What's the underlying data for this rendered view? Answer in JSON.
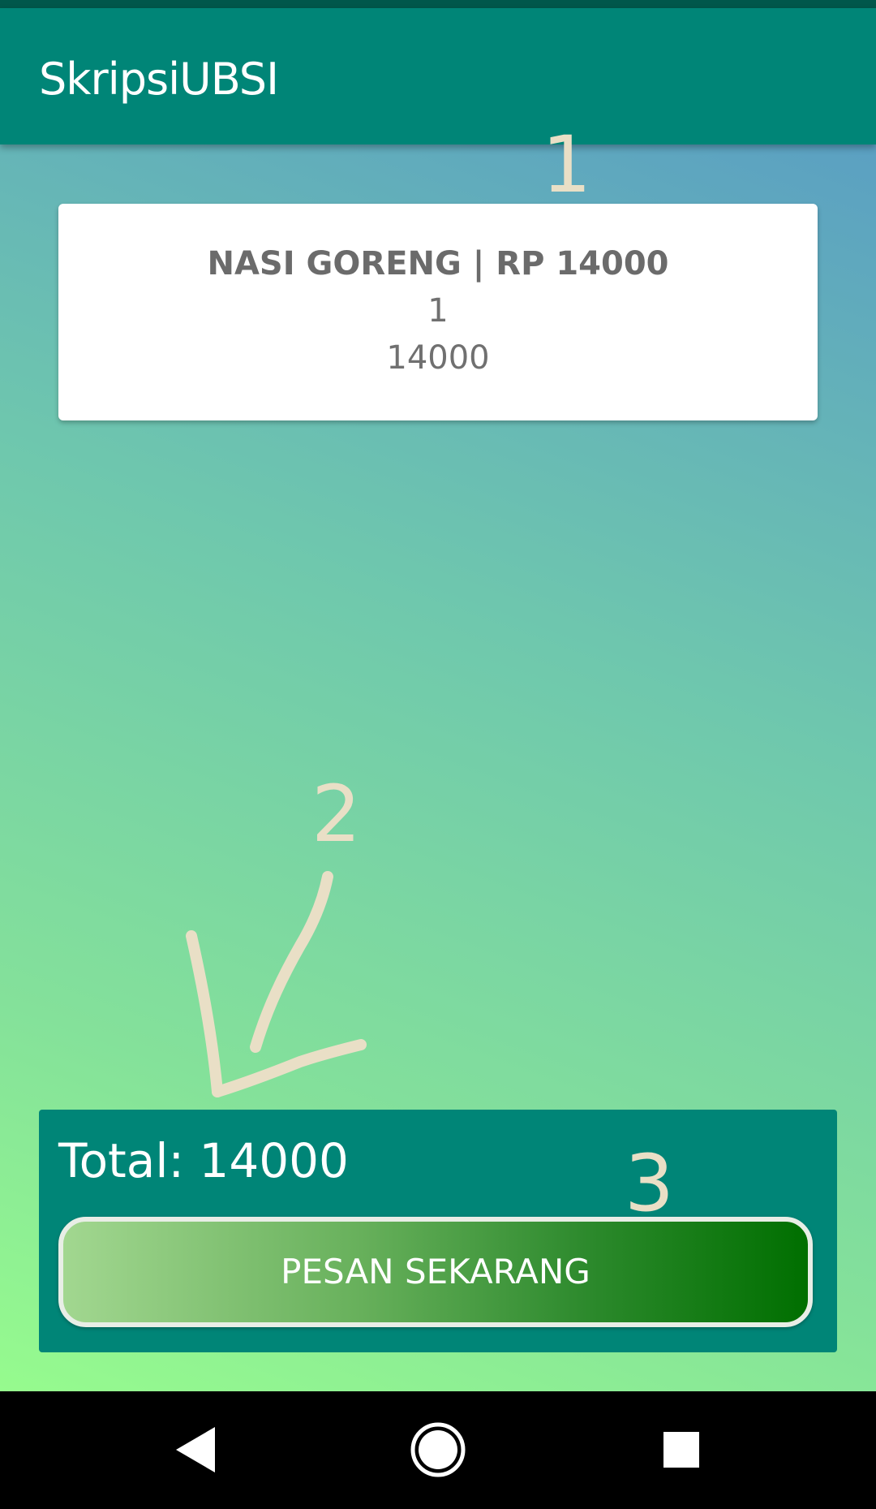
{
  "app_bar": {
    "title": "SkripsiUBSI"
  },
  "order_card": {
    "item_name": "NASI GORENG | RP 14000",
    "quantity": "1",
    "subtotal": "14000"
  },
  "summary": {
    "total_text": "Total: 14000",
    "order_button_label": "PESAN SEKARANG"
  },
  "annotations": {
    "one": "1",
    "two": "2",
    "three": "3"
  },
  "nav_bar": {
    "back_icon": "back-triangle",
    "home_icon": "home-circle",
    "recents_icon": "recents-square"
  },
  "colors": {
    "primary": "#008577",
    "primary_dark": "#00574b",
    "annotation": "#e9dfc6"
  }
}
